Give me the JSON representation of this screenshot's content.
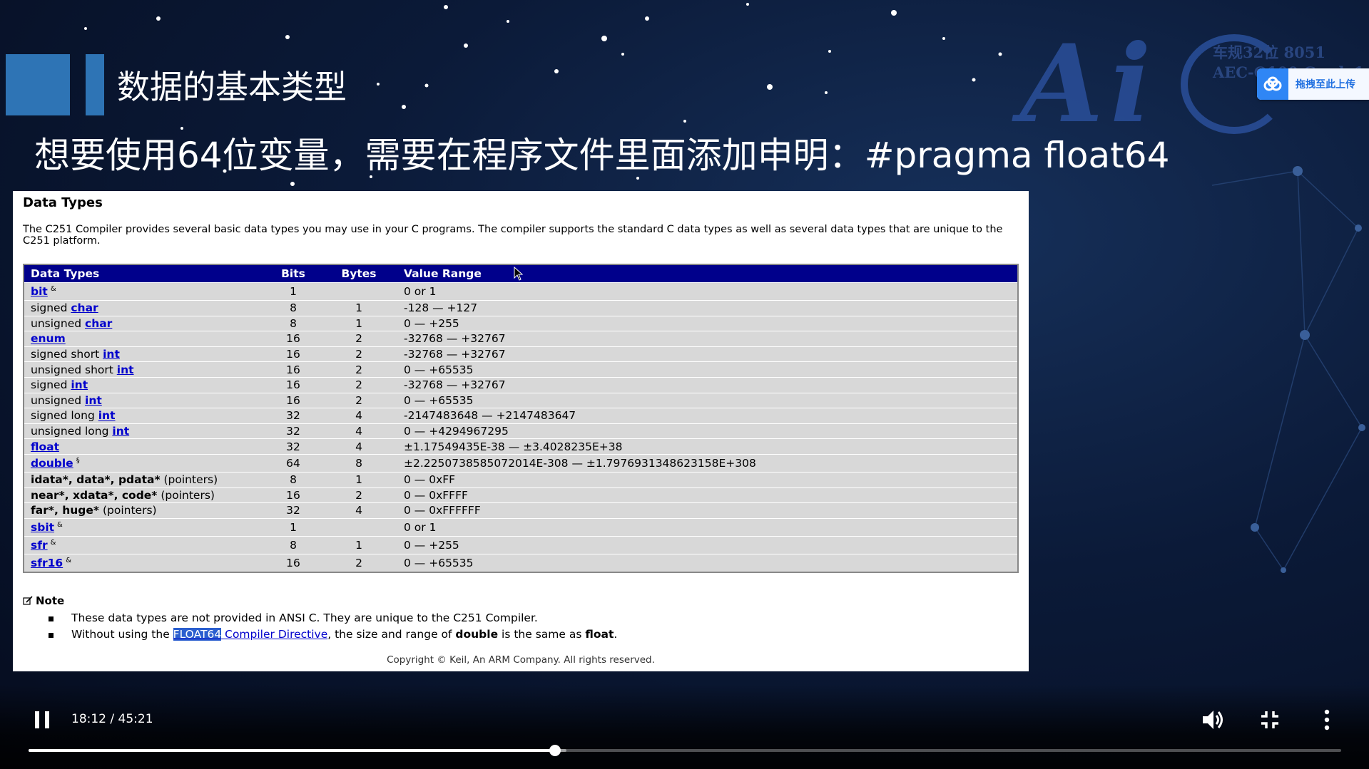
{
  "slide": {
    "title": "数据的基本类型",
    "subtitle": "想要使用64位变量，需要在程序文件里面添加申明：#pragma float64",
    "logo_text": "Ai",
    "logo_caption_line1": "车规32位 8051",
    "logo_caption_line2": "AEC-Q100 Grade1",
    "accent_color": "#2e74b5"
  },
  "upload": {
    "label": "拖拽至此上传",
    "icon": "cloud-upload-icon"
  },
  "doc": {
    "heading": "Data Types",
    "description": "The C251 Compiler provides several basic data types you may use in your C programs. The compiler supports the standard C data types as well as several data types that are unique to the C251 platform.",
    "columns": [
      "Data Types",
      "Bits",
      "Bytes",
      "Value Range"
    ],
    "rows": [
      {
        "prefix": "",
        "keyword": "bit",
        "suffix": "",
        "mark": "&",
        "bits": "1",
        "bytes": "",
        "range": "0 or 1"
      },
      {
        "prefix": "signed ",
        "keyword": "char",
        "suffix": "",
        "mark": "",
        "bits": "8",
        "bytes": "1",
        "range": "-128 — +127"
      },
      {
        "prefix": "unsigned ",
        "keyword": "char",
        "suffix": "",
        "mark": "",
        "bits": "8",
        "bytes": "1",
        "range": "0 — +255"
      },
      {
        "prefix": "",
        "keyword": "enum",
        "suffix": "",
        "mark": "",
        "bits": "16",
        "bytes": "2",
        "range": "-32768 — +32767"
      },
      {
        "prefix": "signed short ",
        "keyword": "int",
        "suffix": "",
        "mark": "",
        "bits": "16",
        "bytes": "2",
        "range": "-32768 — +32767"
      },
      {
        "prefix": "unsigned short ",
        "keyword": "int",
        "suffix": "",
        "mark": "",
        "bits": "16",
        "bytes": "2",
        "range": "0 — +65535"
      },
      {
        "prefix": "signed ",
        "keyword": "int",
        "suffix": "",
        "mark": "",
        "bits": "16",
        "bytes": "2",
        "range": "-32768 — +32767"
      },
      {
        "prefix": "unsigned ",
        "keyword": "int",
        "suffix": "",
        "mark": "",
        "bits": "16",
        "bytes": "2",
        "range": "0 — +65535"
      },
      {
        "prefix": "signed long ",
        "keyword": "int",
        "suffix": "",
        "mark": "",
        "bits": "32",
        "bytes": "4",
        "range": "-2147483648 — +2147483647"
      },
      {
        "prefix": "unsigned long ",
        "keyword": "int",
        "suffix": "",
        "mark": "",
        "bits": "32",
        "bytes": "4",
        "range": "0 — +4294967295"
      },
      {
        "prefix": "",
        "keyword": "float",
        "suffix": "",
        "mark": "",
        "bits": "32",
        "bytes": "4",
        "range": "±1.17549435E-38 — ±3.4028235E+38"
      },
      {
        "prefix": "",
        "keyword": "double",
        "suffix": "",
        "mark": "§",
        "bits": "64",
        "bytes": "8",
        "range": "±2.2250738585072014E-308 — ±1.7976931348623158E+308"
      },
      {
        "bold": "idata*, data*, pdata*",
        "suffix": " (pointers)",
        "bits": "8",
        "bytes": "1",
        "range": "0 — 0xFF"
      },
      {
        "bold": "near*, xdata*, code*",
        "suffix": " (pointers)",
        "bits": "16",
        "bytes": "2",
        "range": "0 — 0xFFFF"
      },
      {
        "bold": "far*, huge*",
        "suffix": " (pointers)",
        "bits": "32",
        "bytes": "4",
        "range": "0 — 0xFFFFFF"
      },
      {
        "prefix": "",
        "keyword": "sbit",
        "suffix": "",
        "mark": "&",
        "bits": "1",
        "bytes": "",
        "range": "0 or 1"
      },
      {
        "prefix": "",
        "keyword": "sfr",
        "suffix": "",
        "mark": "&",
        "bits": "8",
        "bytes": "1",
        "range": "0 — +255"
      },
      {
        "prefix": "",
        "keyword": "sfr16",
        "suffix": "",
        "mark": "&",
        "bits": "16",
        "bytes": "2",
        "range": "0 — +65535"
      }
    ],
    "note": {
      "label": "Note",
      "item1": "These data types are not provided in ANSI C. They are unique to the C251 Compiler.",
      "item2_before": "Without using the ",
      "item2_link_selected": "FLOAT64",
      "item2_link_rest": " Compiler Directive",
      "item2_mid": ", the size and range of ",
      "item2_bold1": "double",
      "item2_mid2": " is the same as ",
      "item2_bold2": "float",
      "item2_end": "."
    },
    "copyright": "Copyright © Keil, An ARM Company. All rights reserved."
  },
  "player": {
    "time": "18:12 / 45:21",
    "progress_fraction": 0.4013,
    "buffer_fraction": 0.41,
    "icons": [
      "pause-icon",
      "volume-icon",
      "exit-fullscreen-icon",
      "more-icon"
    ]
  }
}
